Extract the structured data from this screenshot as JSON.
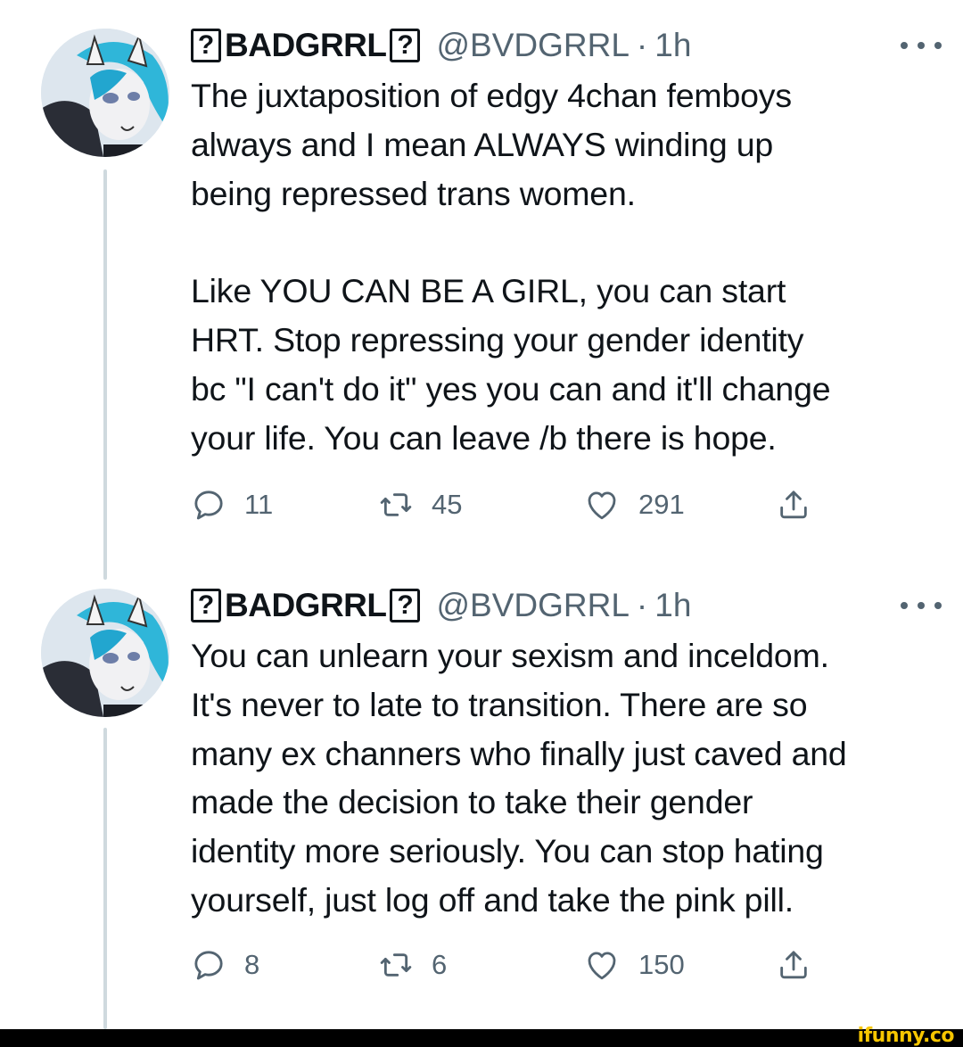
{
  "tweets": [
    {
      "display_name": "BADGRRL",
      "name_glyph": "?",
      "handle": "@BVDGRRL",
      "separator": "·",
      "time": "1h",
      "avatar_icon": "furry-character-avatar",
      "body": "The juxtaposition of edgy 4chan femboys\nalways and I mean ALWAYS winding up\nbeing repressed trans women.\n\nLike YOU CAN BE A GIRL, you can start\nHRT. Stop repressing your gender identity\nbc \"I can't do it\" yes you can and it'll change\nyour life. You can leave /b there is hope.",
      "replies": "11",
      "retweets": "45",
      "likes": "291"
    },
    {
      "display_name": "BADGRRL",
      "name_glyph": "?",
      "handle": "@BVDGRRL",
      "separator": "·",
      "time": "1h",
      "avatar_icon": "furry-character-avatar",
      "body": "You can unlearn your sexism and inceldom.\nIt's never to late to transition. There are so\nmany ex channers who finally just caved and\nmade the decision to take their gender\nidentity more seriously. You can stop hating\nyourself, just log off and take the pink pill.",
      "replies": "8",
      "retweets": "6",
      "likes": "150"
    }
  ],
  "watermark": "ifunny.co",
  "colors": {
    "text": "#0f1419",
    "secondary": "#536471",
    "thread_line": "#cfd9de",
    "avatar_hair": "#2fb6d9",
    "watermark": "#f7c600"
  }
}
